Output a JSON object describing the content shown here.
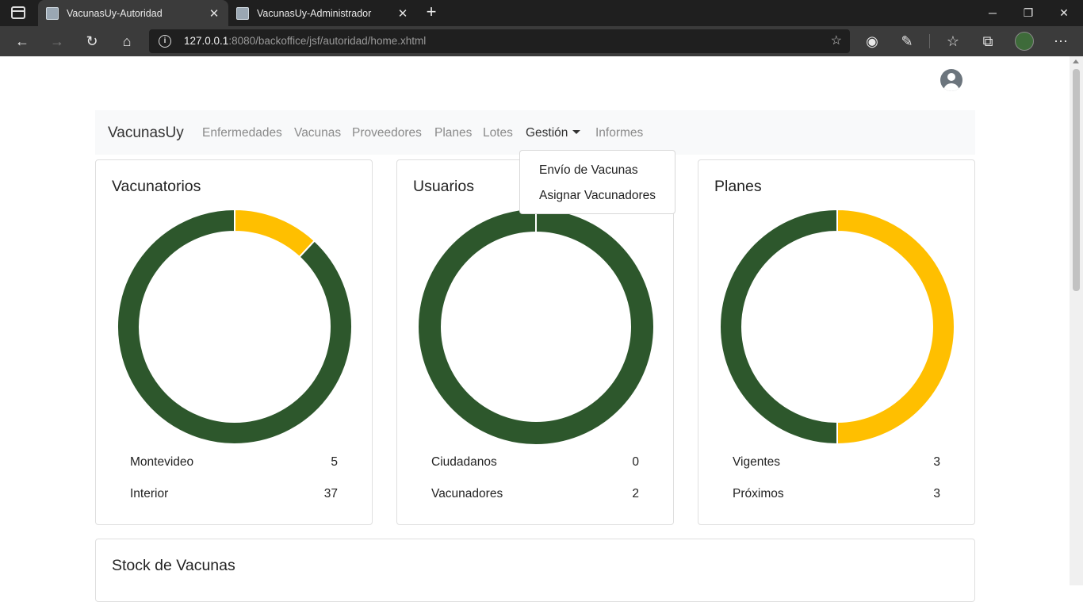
{
  "browser": {
    "tabs": [
      {
        "title": "VacunasUy-Autoridad",
        "active": true
      },
      {
        "title": "VacunasUy-Administrador",
        "active": false
      }
    ],
    "url_host": "127.0.0.1",
    "url_rest": ":8080/backoffice/jsf/autoridad/home.xhtml"
  },
  "navbar": {
    "brand": "VacunasUy",
    "items": [
      "Enfermedades",
      "Vacunas",
      "Proveedores",
      "Planes",
      "Lotes",
      "Gestión",
      "Informes"
    ]
  },
  "dropdown": {
    "items": [
      "Envío de Vacunas",
      "Asignar Vacunadores"
    ]
  },
  "colors": {
    "green": "#2d572c",
    "yellow": "#ffbf00"
  },
  "cards": [
    {
      "title": "Vacunatorios",
      "legend": [
        {
          "label": "Montevideo",
          "value": "5"
        },
        {
          "label": "Interior",
          "value": "37"
        }
      ]
    },
    {
      "title": "Usuarios",
      "legend": [
        {
          "label": "Ciudadanos",
          "value": "0"
        },
        {
          "label": "Vacunadores",
          "value": "2"
        }
      ]
    },
    {
      "title": "Planes",
      "legend": [
        {
          "label": "Vigentes",
          "value": "3"
        },
        {
          "label": "Próximos",
          "value": "3"
        }
      ]
    }
  ],
  "stock": {
    "title": "Stock de Vacunas"
  },
  "chart_data": [
    {
      "type": "pie",
      "title": "Vacunatorios",
      "categories": [
        "Montevideo",
        "Interior"
      ],
      "values": [
        5,
        37
      ],
      "colors": [
        "#ffbf00",
        "#2d572c"
      ]
    },
    {
      "type": "pie",
      "title": "Usuarios",
      "categories": [
        "Ciudadanos",
        "Vacunadores"
      ],
      "values": [
        0,
        2
      ],
      "colors": [
        "#ffbf00",
        "#2d572c"
      ]
    },
    {
      "type": "pie",
      "title": "Planes",
      "categories": [
        "Vigentes",
        "Próximos"
      ],
      "values": [
        3,
        3
      ],
      "colors": [
        "#ffbf00",
        "#2d572c"
      ]
    }
  ]
}
